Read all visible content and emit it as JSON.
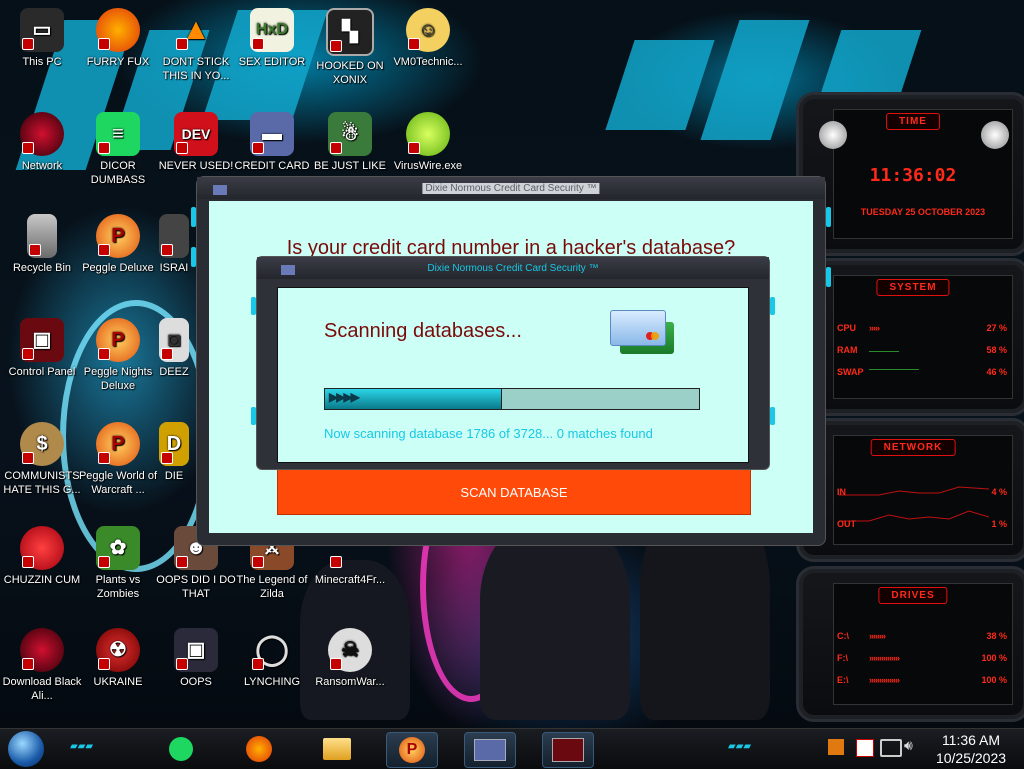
{
  "desktop_icons": [
    {
      "label": "This PC"
    },
    {
      "label": "FURRY FUX"
    },
    {
      "label": "DONT STICK THIS IN YO..."
    },
    {
      "label": "SEX EDITOR"
    },
    {
      "label": "HOOKED ON XONIX"
    },
    {
      "label": "VM0Technic..."
    },
    {
      "label": "Network"
    },
    {
      "label": "DICOR DUMBASS"
    },
    {
      "label": "NEVER USED!"
    },
    {
      "label": "CREDIT CARD"
    },
    {
      "label": "BE JUST LIKE"
    },
    {
      "label": "VirusWire.exe"
    },
    {
      "label": "Recycle Bin"
    },
    {
      "label": "Peggle Deluxe"
    },
    {
      "label": "ISRAI"
    },
    {
      "label": "Control Panel"
    },
    {
      "label": "Peggle Nights Deluxe"
    },
    {
      "label": "DEEZ"
    },
    {
      "label": "COMMUNISTS HATE THIS G..."
    },
    {
      "label": "Peggle World of Warcraft ..."
    },
    {
      "label": "DIE"
    },
    {
      "label": "CHUZZIN CUM"
    },
    {
      "label": "Plants vs Zombies"
    },
    {
      "label": "OOPS DID I DO THAT"
    },
    {
      "label": "The Legend of Zilda"
    },
    {
      "label": "Minecraft4Fr..."
    },
    {
      "label": "Download Black Ali..."
    },
    {
      "label": "UKRAINE"
    },
    {
      "label": "OOPS"
    },
    {
      "label": "LYNCHING"
    },
    {
      "label": "RansomWar..."
    }
  ],
  "main_window": {
    "title": "Dixie Normous Credit Card Security ™",
    "heading": "Is your credit card number in a hacker's database?",
    "scan_button": "SCAN DATABASE"
  },
  "progress_window": {
    "title": "Dixie Normous Credit Card Security ™",
    "heading": "Scanning databases...",
    "progress": 0.47,
    "status": "Now scanning database 1786 of 3728... 0 matches found"
  },
  "gadgets": {
    "time": {
      "header": "TIME",
      "clock": "11:36:02",
      "date": "TUESDAY 25 OCTOBER 2023"
    },
    "system": {
      "header": "SYSTEM",
      "rows": [
        {
          "label": "CPU",
          "value": "27 %"
        },
        {
          "label": "RAM",
          "value": "58 %"
        },
        {
          "label": "SWAP",
          "value": "46 %"
        }
      ]
    },
    "network": {
      "header": "NETWORK",
      "rows": [
        {
          "label": "IN",
          "value": "4 %"
        },
        {
          "label": "OUT",
          "value": "1 %"
        }
      ]
    },
    "drives": {
      "header": "DRIVES",
      "rows": [
        {
          "label": "C:\\",
          "value": "38 %"
        },
        {
          "label": "F:\\",
          "value": "100 %"
        },
        {
          "label": "E:\\",
          "value": "100 %"
        }
      ]
    }
  },
  "taskbar": {
    "time": "11:36 AM",
    "date": "10/25/2023"
  },
  "colors": {
    "accent": "#18c8e6",
    "window_client": "#ccfff5",
    "heading": "#7a0a0a",
    "scan_button": "#ff4a0a",
    "gadget_red": "#ff2a1a"
  }
}
